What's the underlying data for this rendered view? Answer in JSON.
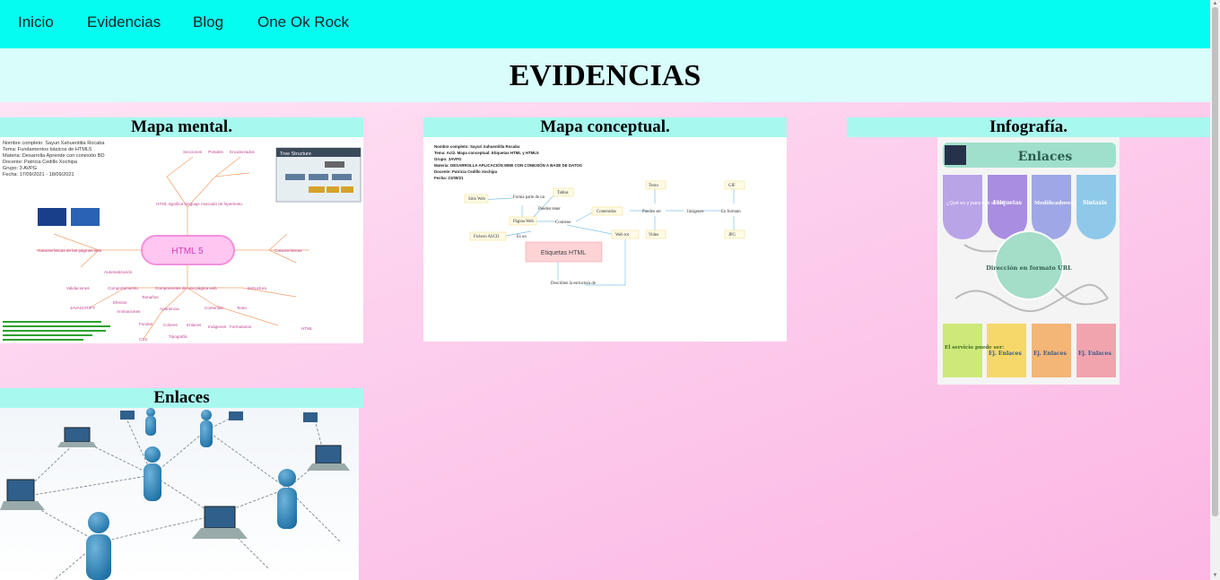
{
  "nav": {
    "items": [
      {
        "label": "Inicio"
      },
      {
        "label": "Evidencias"
      },
      {
        "label": "Blog"
      },
      {
        "label": "One Ok Rock"
      }
    ]
  },
  "header": {
    "title": "EVIDENCIAS"
  },
  "cards": [
    {
      "title": "Mapa mental.",
      "image": {
        "center_label": "HTML 5",
        "heading_lines": [
          "Nombre completo: Sayuri Xahuentitla Rocaba",
          "Tema: Fundamentos básicos de HTML5",
          "Materia: Desarrolla Aprende con conexión BD",
          "Docente: Patricia Cedillo Xochipa",
          "Grupo: 3 AVPG",
          "Fecha: 17/09/2021 - 18/09/2021"
        ],
        "tree_title": "Tree Structure",
        "nodes": [
          "Secciones",
          "Portales",
          "Encabezados",
          "HTML significa lenguaje marcado de hipertexto.",
          "Características de las páginas web",
          "Características",
          "Componentes de una página web",
          "Estructura",
          "Contenido",
          "Apariencia",
          "Comportamiento",
          "Texto",
          "Imágenes",
          "Formularios",
          "Enlaces",
          "Colores",
          "Tipografía",
          "Tamaños",
          "Fondos",
          "CSS",
          "HTML",
          "JAVASCRIPT",
          "Efectos",
          "Animaciones",
          "Validaciones",
          "Automatización"
        ]
      }
    },
    {
      "title": "Mapa conceptual.",
      "image": {
        "heading_lines": [
          "Nombre completo: Sayuri Xahuentitla Rocaba",
          "Tema: Act2. Mapa conceptual: Etiquetas HTML y HTML5",
          "Grupo: 3AVPG",
          "Materia: DESARROLLA APLICACIÓN WEB CON CONEXIÓN A BASE DE DATOS",
          "Docente: Patricia Cedillo Xochipa",
          "Fecha: 21/09/21"
        ],
        "center_label": "Etiquetas HTML",
        "nodes": [
          "Sitio Web",
          "Forma parte de un",
          "Tablas",
          "Pueden tener",
          "Página Web",
          "Contiene",
          "Contenidos",
          "Pueden ser",
          "Texto",
          "Imágenes",
          "En formato",
          "GIF",
          "JPG",
          "Video",
          "Web tot",
          "Fichero ASCII",
          "Es un",
          "Describen la estructura de"
        ]
      }
    },
    {
      "title": "Infografía.",
      "image": {
        "title": "Enlaces",
        "top_cards": [
          "Etiquetas",
          "Modificadores",
          "Sintaxis"
        ],
        "question": "¿Qué es y para qué sirve?",
        "bubble": "Dirección en formato URL",
        "bottom_cards": [
          "El servicio puede ser:",
          "Ej. Enlaces",
          "Ej. Enlaces",
          "Ej. Enlaces"
        ]
      }
    },
    {
      "title": "Enlaces"
    }
  ],
  "colors": {
    "nav_bg": "#04fdf0",
    "header_bg": "#d8fdfb",
    "card_title_bg": "#a7f9ef"
  }
}
